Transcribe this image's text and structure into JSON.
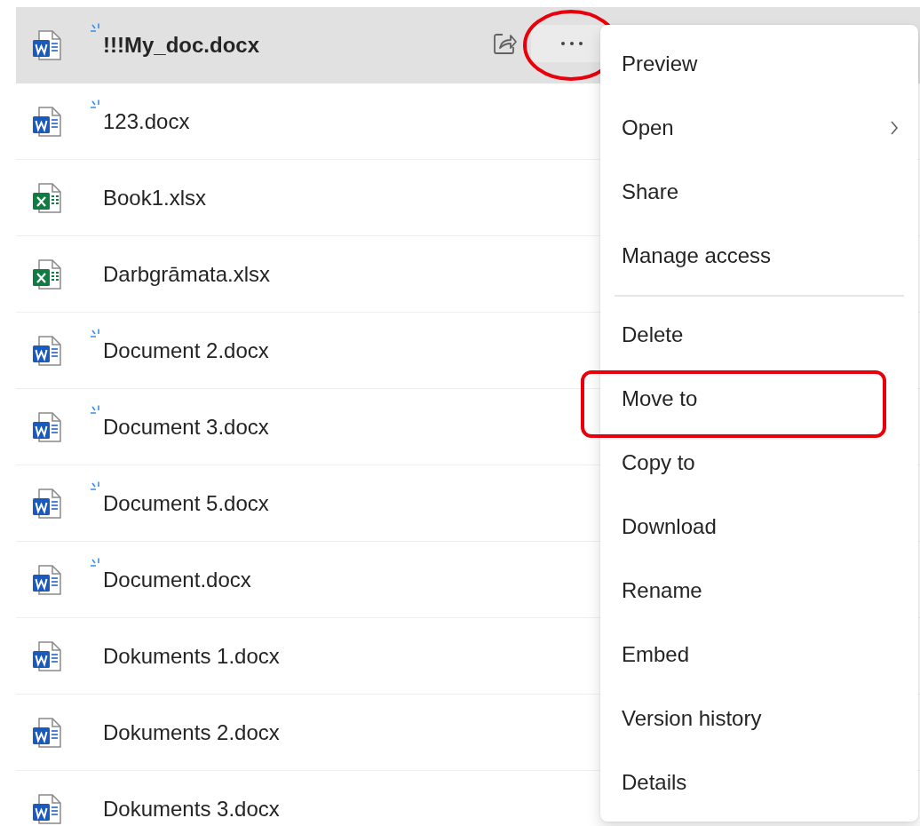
{
  "files": [
    {
      "name": "!!!My_doc.docx",
      "kind": "word",
      "is_new": true,
      "selected": true,
      "actions": {
        "share": true,
        "more_annotated": true
      }
    },
    {
      "name": "123.docx",
      "kind": "word",
      "is_new": true,
      "selected": false
    },
    {
      "name": "Book1.xlsx",
      "kind": "excel",
      "is_new": false,
      "selected": false
    },
    {
      "name": "Darbgrāmata.xlsx",
      "kind": "excel",
      "is_new": false,
      "selected": false
    },
    {
      "name": "Document 2.docx",
      "kind": "word",
      "is_new": true,
      "selected": false
    },
    {
      "name": "Document 3.docx",
      "kind": "word",
      "is_new": true,
      "selected": false
    },
    {
      "name": "Document 5.docx",
      "kind": "word",
      "is_new": true,
      "selected": false
    },
    {
      "name": "Document.docx",
      "kind": "word",
      "is_new": true,
      "selected": false
    },
    {
      "name": "Dokuments 1.docx",
      "kind": "word",
      "is_new": false,
      "selected": false
    },
    {
      "name": "Dokuments 2.docx",
      "kind": "word",
      "is_new": false,
      "selected": false
    },
    {
      "name": "Dokuments 3.docx",
      "kind": "word",
      "is_new": false,
      "selected": false
    }
  ],
  "context_menu": {
    "items": [
      {
        "label": "Preview",
        "has_submenu": false,
        "annotated": false,
        "divider_after": false
      },
      {
        "label": "Open",
        "has_submenu": true,
        "annotated": false,
        "divider_after": false
      },
      {
        "label": "Share",
        "has_submenu": false,
        "annotated": false,
        "divider_after": false
      },
      {
        "label": "Manage access",
        "has_submenu": false,
        "annotated": false,
        "divider_after": true
      },
      {
        "label": "Delete",
        "has_submenu": false,
        "annotated": false,
        "divider_after": false
      },
      {
        "label": "Move to",
        "has_submenu": false,
        "annotated": true,
        "divider_after": false
      },
      {
        "label": "Copy to",
        "has_submenu": false,
        "annotated": false,
        "divider_after": false
      },
      {
        "label": "Download",
        "has_submenu": false,
        "annotated": false,
        "divider_after": false
      },
      {
        "label": "Rename",
        "has_submenu": false,
        "annotated": false,
        "divider_after": false
      },
      {
        "label": "Embed",
        "has_submenu": false,
        "annotated": false,
        "divider_after": false
      },
      {
        "label": "Version history",
        "has_submenu": false,
        "annotated": false,
        "divider_after": false
      },
      {
        "label": "Details",
        "has_submenu": false,
        "annotated": false,
        "divider_after": false
      }
    ]
  }
}
